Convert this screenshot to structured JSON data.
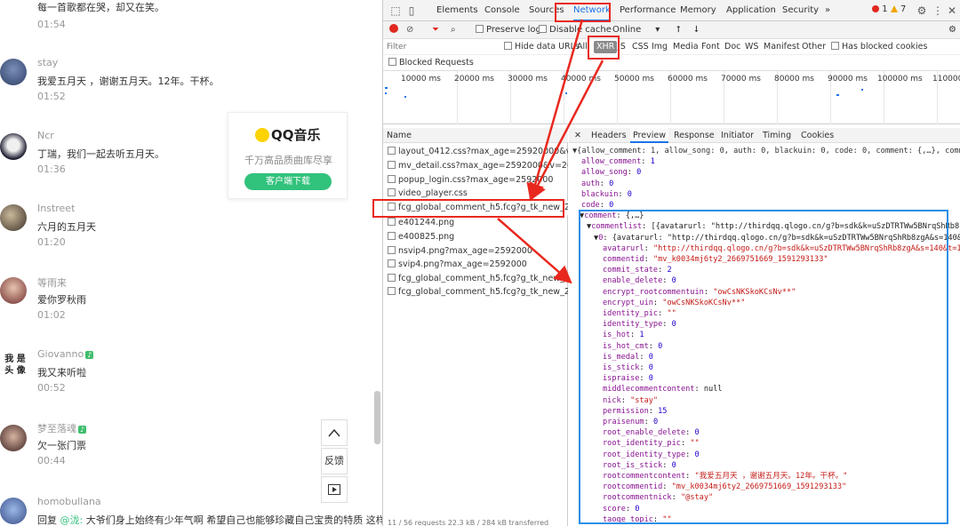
{
  "comments": [
    {
      "nick": "",
      "text": "每一首歌都在哭，却又在笑。",
      "time": "01:54"
    },
    {
      "nick": "stay",
      "text": "我爱五月天 ，谢谢五月天。12年。干杯。",
      "time": "01:52"
    },
    {
      "nick": "Ncr",
      "text": "丁瑞，我们一起去听五月天。",
      "time": "01:36"
    },
    {
      "nick": "Instreet",
      "text": "六月的五月天",
      "time": "01:20"
    },
    {
      "nick": "等雨来",
      "text": "爱你罗秋雨",
      "time": "01:02"
    },
    {
      "nick": "Giovanno",
      "text": "我又来听啦",
      "time": "00:52",
      "avatar_text": "我 是\n头 像"
    },
    {
      "nick": "梦至落魂",
      "text": "欠一张门票",
      "time": "00:44"
    },
    {
      "nick": "homobullana",
      "text_prefix": "回复 ",
      "reply_at": "@泷:",
      "text": " 大爷们身上始终有少年气啊 希望自己也能够珍藏自己宝贵的特质 这样",
      "time": ""
    }
  ],
  "qq_card": {
    "brand": "QQ音乐",
    "slogan": "千万高品质曲库尽享",
    "download": "客户端下载"
  },
  "side_buttons": {
    "up_icon": "chevron-up-icon",
    "feedback": "反馈",
    "video_icon": "play-icon"
  },
  "devtools": {
    "tabs": [
      "Elements",
      "Console",
      "Sources",
      "Network",
      "Performance",
      "Memory",
      "Application",
      "Security",
      "»"
    ],
    "active_tab": "Network",
    "error_count": "1",
    "warning_count": "7",
    "toolbar": {
      "preserve_log": "Preserve log",
      "disable_cache": "Disable cache",
      "throttle": "Online"
    },
    "filter_placeholder": "Filter",
    "hide_data_urls": "Hide data URLs",
    "filter_types": [
      "All",
      "XHR",
      "JS",
      "CSS",
      "Img",
      "Media",
      "Font",
      "Doc",
      "WS",
      "Manifest",
      "Other"
    ],
    "active_filter": "XHR",
    "has_blocked_cookies": "Has blocked cookies",
    "blocked_requests": "Blocked Requests",
    "timeline_ticks": [
      "10000 ms",
      "20000 ms",
      "30000 ms",
      "40000 ms",
      "50000 ms",
      "60000 ms",
      "70000 ms",
      "80000 ms",
      "90000 ms",
      "100000 ms",
      "110000"
    ],
    "name_header": "Name",
    "requests": [
      "layout_0412.css?max_age=25920000&v=2...",
      "mv_detail.css?max_age=2592000&v=2018...",
      "popup_login.css?max_age=2592000",
      "video_player.css",
      "fcg_global_comment_h5.fcg?g_tk_new_2020...",
      "e401244.png",
      "e400825.png",
      "nsvip4.png?max_age=2592000",
      "svip4.png?max_age=2592000",
      "fcg_global_comment_h5.fcg?g_tk_new_2020...",
      "fcg_global_comment_h5.fcg?g_tk_new_2020..."
    ],
    "footer": "11 / 56 requests   22.3 kB / 284 kB transferred",
    "detail_tabs": [
      "Headers",
      "Preview",
      "Response",
      "Initiator",
      "Timing",
      "Cookies"
    ],
    "active_detail_tab": "Preview",
    "preview_lines": [
      "▼{allow_comment: 1, allow_song: 0, auth: 0, blackuin: 0, code: 0, comment: {,…}, comme",
      "allow_comment: 1",
      "allow_song: 0",
      "auth: 0",
      "blackuin: 0",
      "code: 0",
      "▼comment: {,…}",
      "▼commentlist: [{avatarurl: \"http://thirdqq.qlogo.cn/g?b=sdk&k=uSzDTRTWw5BNrqShRb8zg",
      "▼0: {avatarurl: \"http://thirdqq.qlogo.cn/g?b=sdk&k=uSzDTRTWw5BNrqShRb8zgA&s=140&t",
      "avatarurl: \"http://thirdqq.qlogo.cn/g?b=sdk&k=uSzDTRTWw5BNrqShRb8zgA&s=140&t=15",
      "commentid: \"mv_k0034mj6ty2_2669751669_1591293133\"",
      "commit_state: 2",
      "enable_delete: 0",
      "encrypt_rootcommentuin: \"owCsNKSkoKCsNv**\"",
      "encrypt_uin: \"owCsNKSkoKCsNv**\"",
      "identity_pic: \"\"",
      "identity_type: 0",
      "is_hot: 1",
      "is_hot_cmt: 0",
      "is_medal: 0",
      "is_stick: 0",
      "ispraise: 0",
      "middlecommentcontent: null",
      "nick: \"stay\"",
      "permission: 15",
      "praisenum: 0",
      "root_enable_delete: 0",
      "root_identity_pic: \"\"",
      "root_identity_type: 0",
      "root_is_stick: 0",
      "rootcommentcontent: \"我爱五月天 ，谢谢五月天。12年。干杯。\"",
      "rootcommentid: \"mv_k0034mj6ty2_2669751669_1591293133\"",
      "rootcommentnick: \"@stay\"",
      "score: 0",
      "taoge_topic: \"\""
    ]
  },
  "colors": {
    "accent_green": "#31c27c",
    "annotation_red": "#e8281e",
    "annotation_blue": "#2b8ee6",
    "devtools_blue": "#1a73e8"
  }
}
